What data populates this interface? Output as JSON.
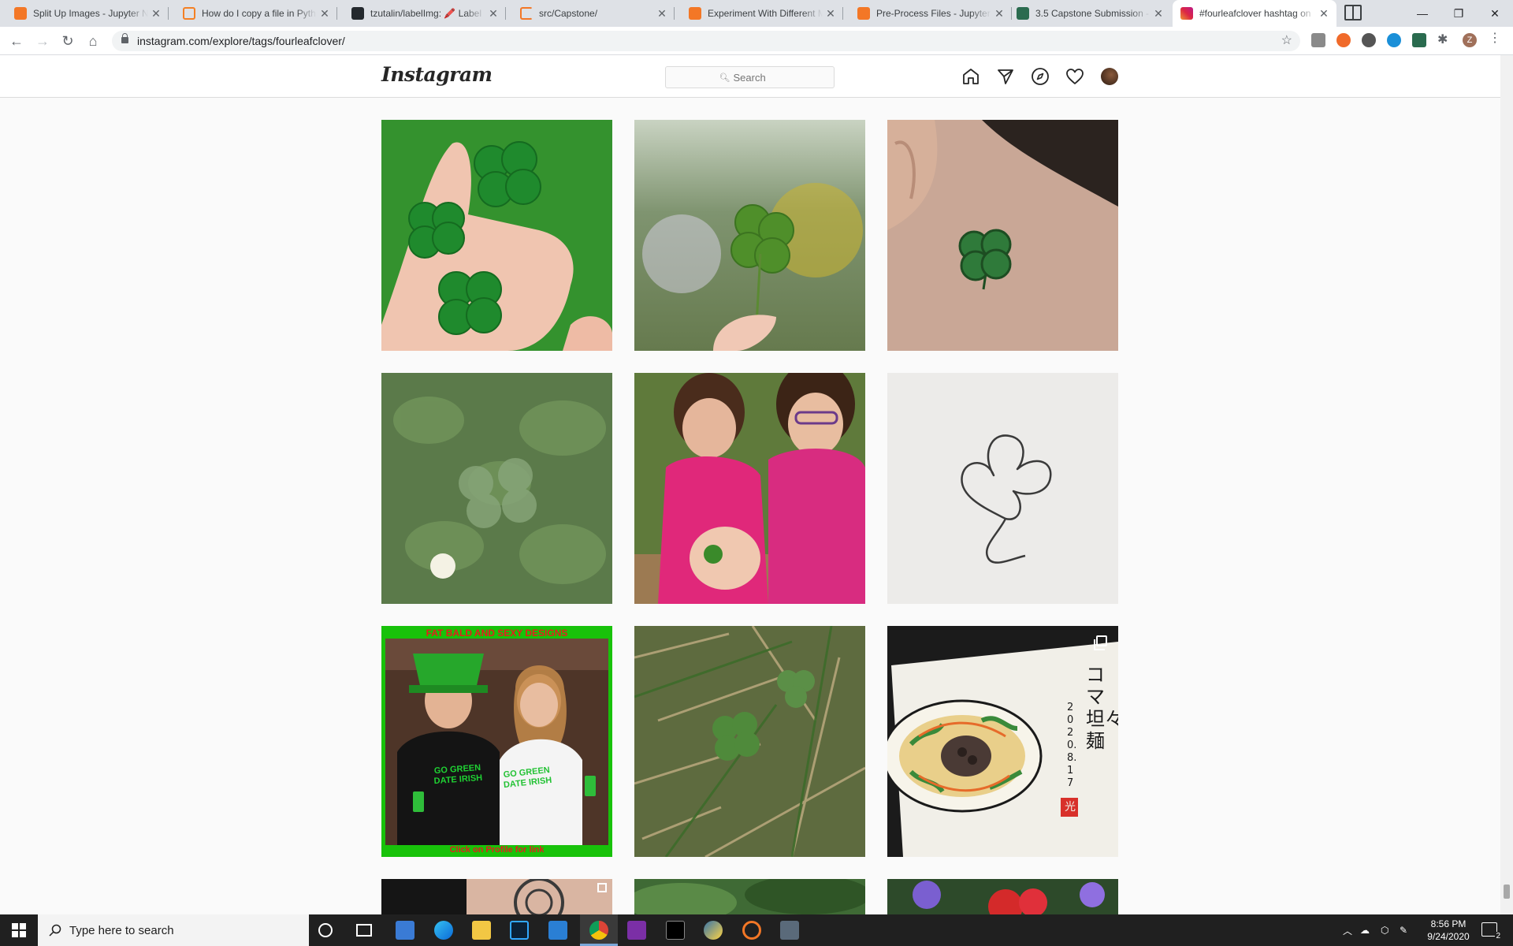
{
  "browser": {
    "tabs": [
      {
        "title": "Split Up Images - Jupyter N",
        "favicon": "jupyter-icon",
        "active": false
      },
      {
        "title": "How do I copy a file in Pyth",
        "favicon": "stackoverflow-icon",
        "active": false
      },
      {
        "title": "tzutalin/labelImg: 🖍️ Label",
        "favicon": "github-icon",
        "active": false
      },
      {
        "title": "src/Capstone/",
        "favicon": "loading-icon",
        "active": false
      },
      {
        "title": "Experiment With Different M",
        "favicon": "jupyter-icon",
        "active": false
      },
      {
        "title": "Pre-Process Files - Jupyter N",
        "favicon": "jupyter-icon",
        "active": false
      },
      {
        "title": "3.5 Capstone Submission - I",
        "favicon": "edx-icon",
        "active": false
      },
      {
        "title": "#fourleafclover hashtag on",
        "favicon": "instagram-icon",
        "active": true
      }
    ],
    "url": "instagram.com/explore/tags/fourleafclover/",
    "profile_initial": "Z"
  },
  "instagram": {
    "logo": "Instagram",
    "search_placeholder": "Search",
    "nav_icons": [
      "home-icon",
      "direct-icon",
      "explore-icon",
      "activity-heart-icon",
      "profile-avatar"
    ]
  },
  "posts": [
    {
      "subject": "four-leaf-clovers-in-hand",
      "bg": "#2f8a2a"
    },
    {
      "subject": "clover-held-in-meadow",
      "bg": "#7c8e66"
    },
    {
      "subject": "clover-tattoo-behind-ear",
      "bg": "#b8998a"
    },
    {
      "subject": "clover-leaves-closeup",
      "bg": "#5b7a4a"
    },
    {
      "subject": "girls-holding-clover",
      "bg": "#c04a8a"
    },
    {
      "subject": "clover-line-drawing",
      "bg": "#ecebe9"
    },
    {
      "subject": "couple-green-shirts",
      "bg": "#1f2b1e",
      "banner_top": "FAT BALD AND SEXY DESIGNS",
      "banner_bottom": "Click on Profile for link",
      "shirt_text": "GO GREEN DATE IRISH",
      "multiple": false
    },
    {
      "subject": "clover-in-grass",
      "bg": "#5e6b3f"
    },
    {
      "subject": "ramen-painting",
      "bg": "#1b1b1b",
      "multiple": true,
      "vertical_text": "コマ坦々麺",
      "date_text": "2020.8.17",
      "seal": "光"
    }
  ],
  "taskbar": {
    "search_placeholder": "Type here to search",
    "time": "8:56 PM",
    "date": "9/24/2020",
    "notification_count": "2"
  }
}
